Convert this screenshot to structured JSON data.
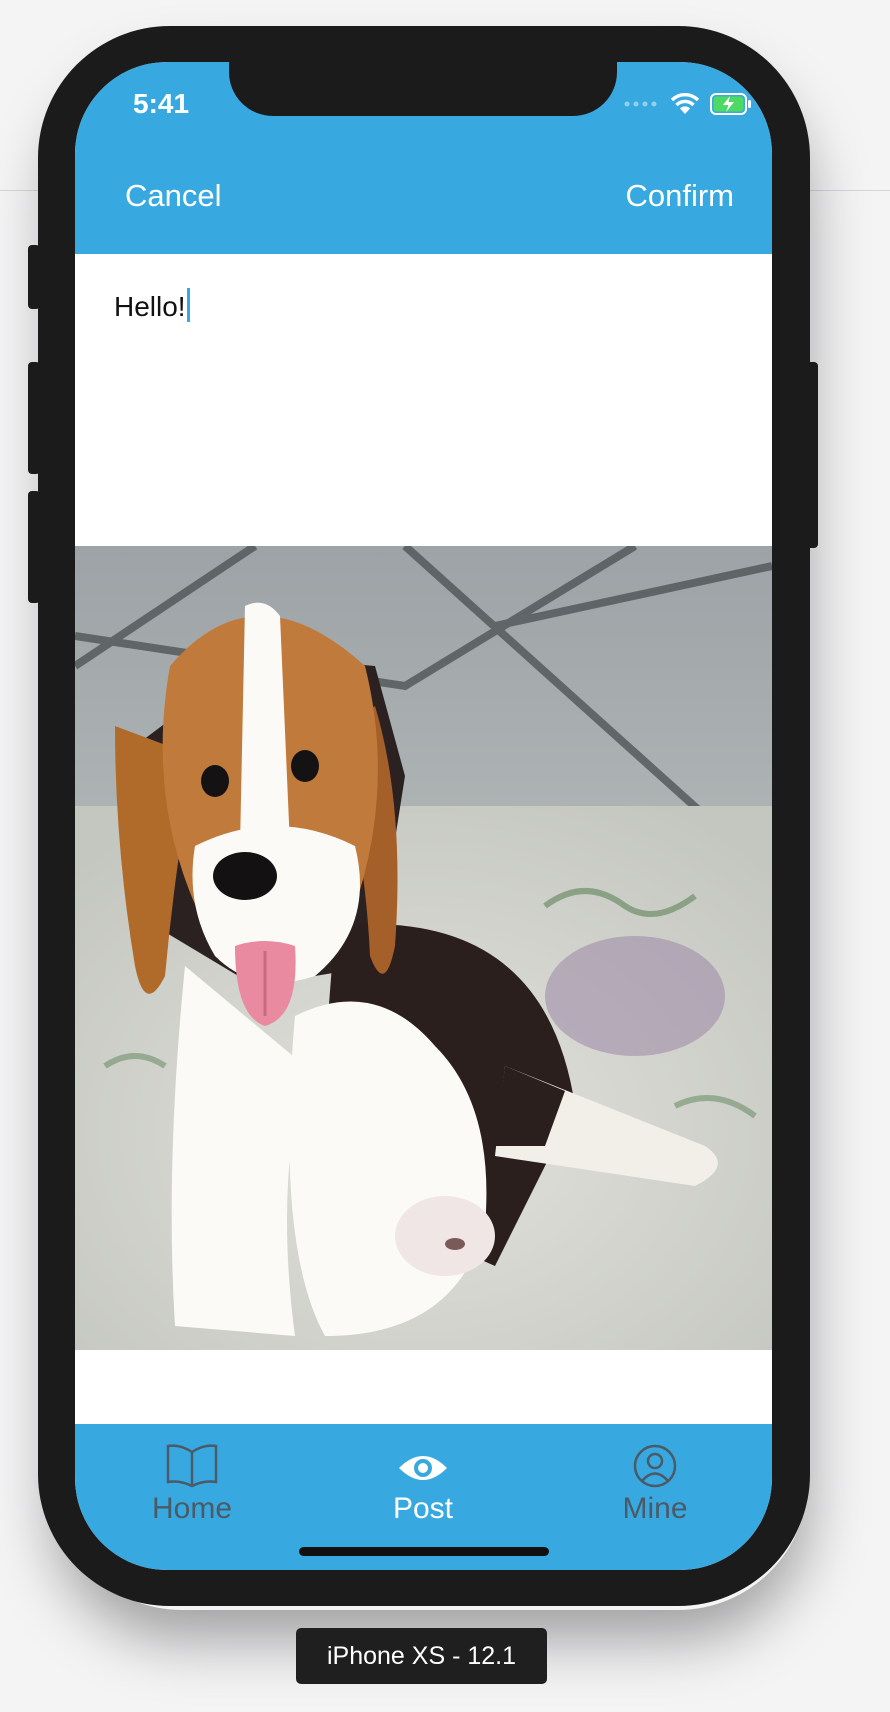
{
  "status_bar": {
    "time": "5:41"
  },
  "nav": {
    "cancel_label": "Cancel",
    "confirm_label": "Confirm"
  },
  "composer": {
    "text_value": "Hello!"
  },
  "tabs": [
    {
      "label": "Home",
      "icon": "book-icon",
      "active": false
    },
    {
      "label": "Post",
      "icon": "eye-icon",
      "active": true
    },
    {
      "label": "Mine",
      "icon": "user-circle-icon",
      "active": false
    }
  ],
  "device_label": "iPhone XS - 12.1",
  "colors": {
    "accent": "#38a9e0",
    "tab_active": "#ffffff",
    "tab_inactive": "#4a5a66",
    "battery_fill": "#4cd964"
  }
}
